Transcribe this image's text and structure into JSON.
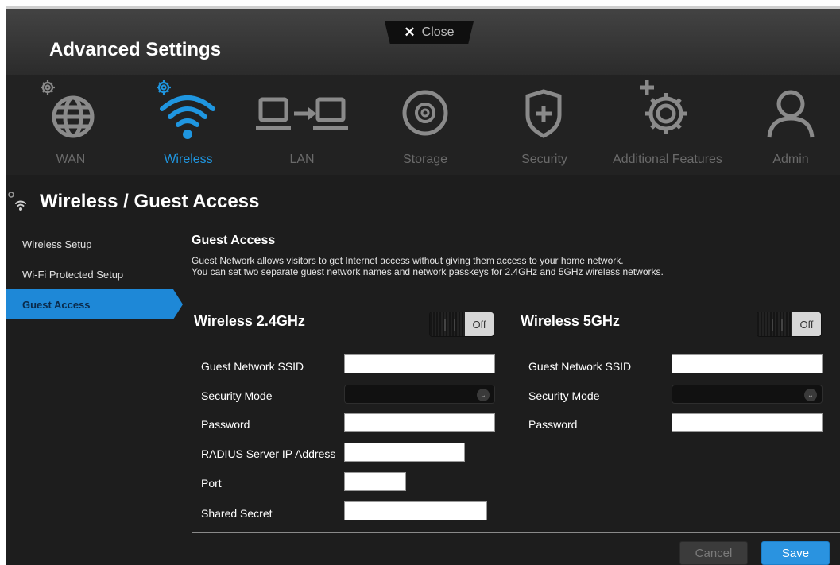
{
  "app": {
    "title": "Advanced Settings",
    "close_label": "Close"
  },
  "nav": {
    "items": [
      {
        "label": "WAN",
        "icon": "globe-gear-icon",
        "active": false
      },
      {
        "label": "Wireless",
        "icon": "wifi-gear-icon",
        "active": true
      },
      {
        "label": "LAN",
        "icon": "lan-computers-icon",
        "active": false
      },
      {
        "label": "Storage",
        "icon": "disk-icon",
        "active": false
      },
      {
        "label": "Security",
        "icon": "shield-icon",
        "active": false
      },
      {
        "label": "Additional Features",
        "icon": "gear-plus-icon",
        "active": false
      },
      {
        "label": "Admin",
        "icon": "user-icon",
        "active": false
      }
    ],
    "active_color": "#1f96e0",
    "inactive_color": "#6a6a6a"
  },
  "section": {
    "title": "Wireless / Guest Access",
    "icon": "wifi-small-icon"
  },
  "sidebar": {
    "items": [
      {
        "label": "Wireless Setup",
        "active": false
      },
      {
        "label": "Wi-Fi Protected Setup",
        "active": false
      },
      {
        "label": "Guest Access",
        "active": true
      }
    ]
  },
  "content": {
    "heading": "Guest Access",
    "desc_line1": "Guest Network allows visitors to get Internet access without giving them access to your home network.",
    "desc_line2": "You can set two separate guest network names and network passkeys for 2.4GHz and 5GHz wireless networks.",
    "band24": {
      "title": "Wireless 2.4GHz",
      "toggle_label": "Off",
      "ssid_label": "Guest Network SSID",
      "ssid_value": "",
      "security_label": "Security Mode",
      "security_value": "",
      "password_label": "Password",
      "password_value": "",
      "radius_label": "RADIUS Server IP Address",
      "radius_value": "",
      "port_label": "Port",
      "port_value": "",
      "secret_label": "Shared Secret",
      "secret_value": ""
    },
    "band5": {
      "title": "Wireless 5GHz",
      "toggle_label": "Off",
      "ssid_label": "Guest Network SSID",
      "ssid_value": "",
      "security_label": "Security Mode",
      "security_value": "",
      "password_label": "Password",
      "password_value": ""
    }
  },
  "footer": {
    "cancel_label": "Cancel",
    "save_label": "Save",
    "save_color": "#2a93e0"
  }
}
